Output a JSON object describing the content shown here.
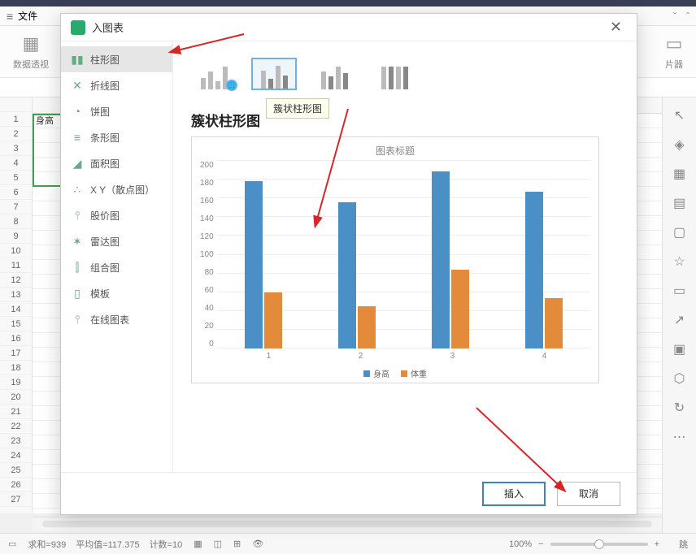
{
  "header": {
    "file_label": "文件"
  },
  "toolbar": {
    "pivot_label": "数据透视",
    "slicer_label": "片器"
  },
  "sheet": {
    "cell_a1": "身高"
  },
  "statusbar": {
    "sum_label": "求和=939",
    "avg_label": "平均值=117.375",
    "count_label": "计数=10",
    "zoom_label": "100%",
    "jump_label": "跳"
  },
  "dialog": {
    "title": "入图表",
    "tooltip": "簇状柱形图",
    "section_title": "簇状柱形图",
    "insert_btn": "插入",
    "cancel_btn": "取消",
    "categories": [
      {
        "label": "柱形图",
        "icon": "▮▮"
      },
      {
        "label": "折线图",
        "icon": "✕"
      },
      {
        "label": "饼图",
        "icon": "◔"
      },
      {
        "label": "条形图",
        "icon": "≡"
      },
      {
        "label": "面积图",
        "icon": "◢"
      },
      {
        "label": "X Y（散点图）",
        "icon": "∴"
      },
      {
        "label": "股价图",
        "icon": "⫯"
      },
      {
        "label": "雷达图",
        "icon": "✶"
      },
      {
        "label": "组合图",
        "icon": "⫿"
      },
      {
        "label": "模板",
        "icon": "▯"
      },
      {
        "label": "在线图表",
        "icon": "⫯"
      }
    ]
  },
  "chart_data": {
    "type": "bar",
    "title": "图表标题",
    "categories": [
      "1",
      "2",
      "3",
      "4"
    ],
    "series": [
      {
        "name": "身高",
        "values": [
          178,
          156,
          189,
          167
        ],
        "color": "#4a90c7"
      },
      {
        "name": "体重",
        "values": [
          60,
          45,
          84,
          54
        ],
        "color": "#e48a3b"
      }
    ],
    "ylim": [
      0,
      200
    ],
    "y_ticks": [
      0,
      20,
      40,
      60,
      80,
      100,
      120,
      140,
      160,
      180,
      200
    ],
    "xlabel": "",
    "ylabel": ""
  }
}
